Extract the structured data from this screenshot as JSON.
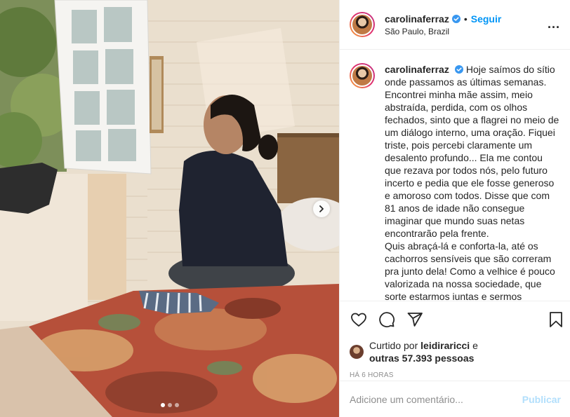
{
  "post": {
    "username": "carolinaferraz",
    "follow_label": "Seguir",
    "separator": "•",
    "location": "São Paulo, Brazil",
    "more_label": "...",
    "caption": "Hoje saímos do sítio onde passamos as últimas semanas. Encontrei minha mãe assim, meio abstraída, perdida, com os olhos fechados, sinto que a flagrei no meio de um diálogo interno, uma oração. Fiquei triste, pois percebi claramente um desalento profundo... Ela me contou que rezava por todos nós, pelo futuro incerto e pedia que ele fosse generoso e amoroso com todos. Disse que com 81 anos de idade não consegue imaginar que mundo suas netas encontrarão pela frente.\nQuis abraçá-lá e conforta-la, até os cachorros sensíveis que são correram pra junto dela! Como a velhice é pouco valorizada na nossa sociedade, que sorte estarmos juntas e sermos",
    "likes_prefix": "Curtido por ",
    "liked_by_user": "leidiraricci",
    "likes_conjunction": " e",
    "likes_others": "outras 57.393 pessoas",
    "time_ago": "HÁ 6 HORAS",
    "carousel_count": 3,
    "carousel_active": 1
  },
  "comment": {
    "placeholder": "Adicione um comentário...",
    "publish_label": "Publicar"
  },
  "icons": {
    "verified": "verified-badge-icon",
    "like": "heart-icon",
    "comment": "comment-icon",
    "share": "share-icon",
    "save": "bookmark-icon",
    "next": "chevron-right-icon"
  },
  "colors": {
    "link": "#0095f6",
    "publish_disabled": "#b2dffc",
    "verified": "#3897f0",
    "muted": "#8e8e8e"
  }
}
